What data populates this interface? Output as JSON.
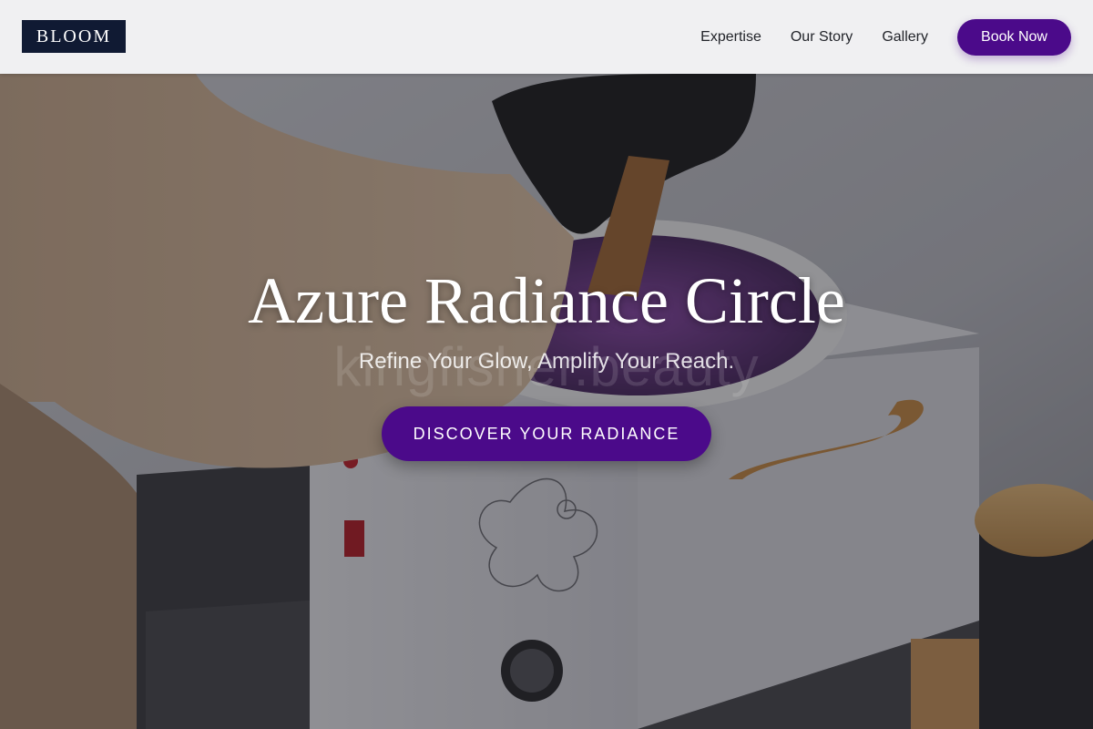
{
  "brand": {
    "logo_text": "BLOOM"
  },
  "nav": {
    "links": [
      {
        "label": "Expertise"
      },
      {
        "label": "Our Story"
      },
      {
        "label": "Gallery"
      }
    ],
    "book_label": "Book Now"
  },
  "hero": {
    "title": "Azure Radiance Circle",
    "subtitle": "Refine Your Glow, Amplify Your Reach.",
    "cta_label": "DISCOVER YOUR RADIANCE",
    "watermark": "kingfisher.beauty",
    "background_image": "wax-warmer-photo"
  },
  "colors": {
    "accent": "#4b0a8a",
    "logo_bg": "#101a33",
    "header_bg": "#f0f0f2",
    "nav_text": "#22242a"
  }
}
